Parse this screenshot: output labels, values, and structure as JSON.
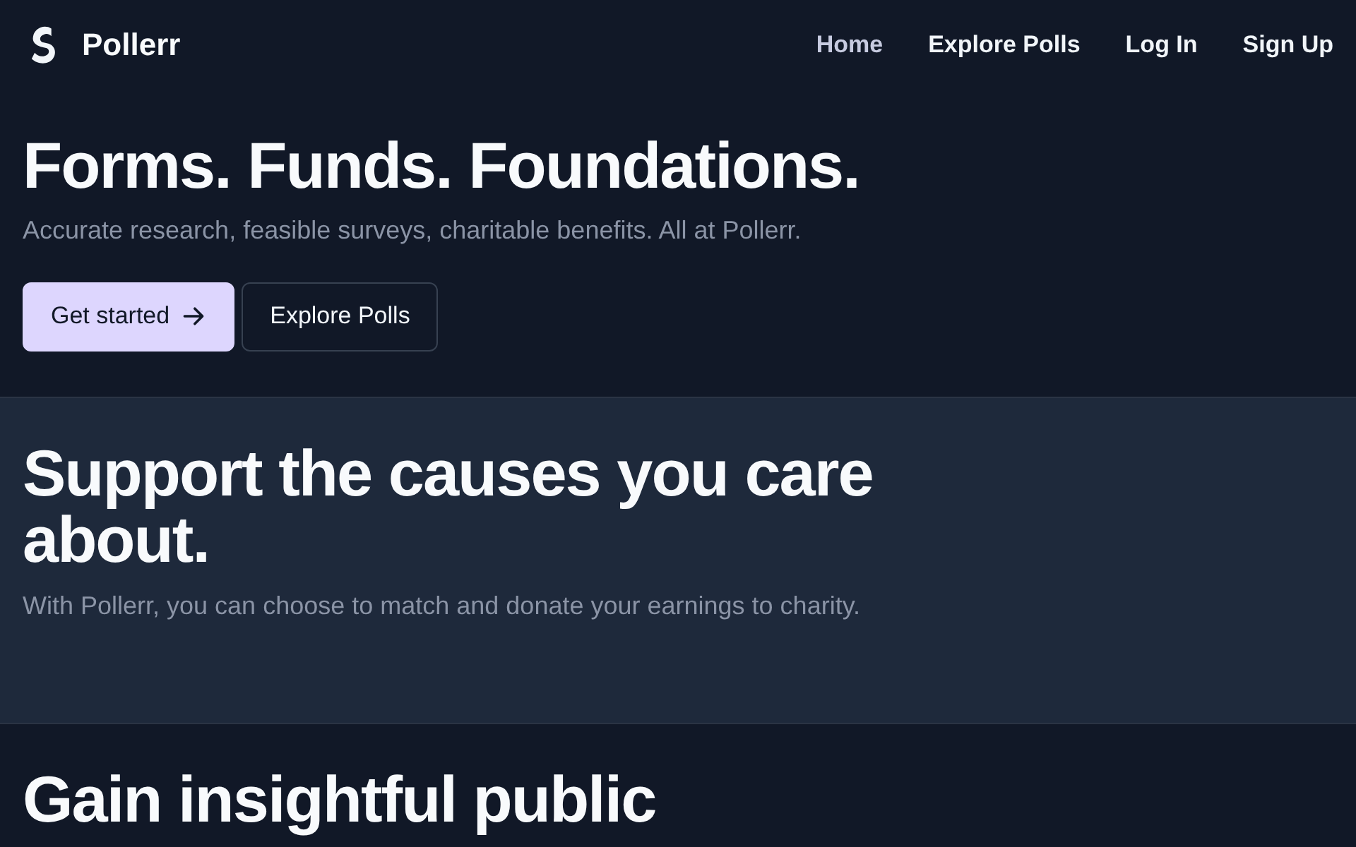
{
  "brand": {
    "name": "Pollerr"
  },
  "nav": [
    {
      "label": "Home",
      "selected": true
    },
    {
      "label": "Explore Polls",
      "selected": false
    },
    {
      "label": "Log In",
      "selected": false
    },
    {
      "label": "Sign Up",
      "selected": false
    }
  ],
  "hero": {
    "title": "Forms. Funds. Foundations.",
    "subtitle": "Accurate research, feasible surveys, charitable benefits. All at Pollerr.",
    "buttons": [
      {
        "label": "Get started",
        "kind": "primary"
      },
      {
        "label": "Explore Polls",
        "kind": "outline"
      }
    ]
  },
  "sections": [
    {
      "title": "Support the causes you care about.",
      "text": "With Pollerr, you can choose to match and donate your earnings to charity.",
      "kind": "alt"
    },
    {
      "title": "Gain insightful public",
      "kind": "plain"
    }
  ]
}
